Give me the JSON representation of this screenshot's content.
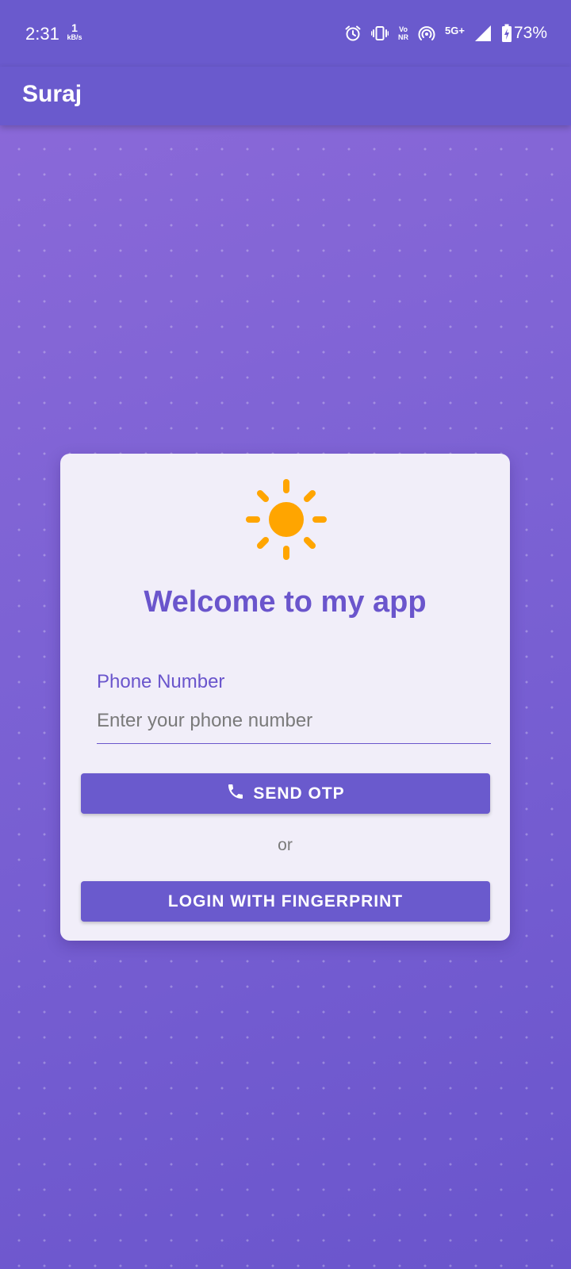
{
  "status_bar": {
    "time": "2:31",
    "net_speed_value": "1",
    "net_speed_unit": "kB/s",
    "icons": [
      "alarm-icon",
      "vibrate-icon",
      "vonr-icon",
      "hotspot-icon",
      "5g-plus-icon",
      "signal-icon",
      "battery-charging-icon"
    ],
    "vo_label": "Vo",
    "nr_label": "NR",
    "network_label": "5G+",
    "battery_percent": "73%"
  },
  "app_bar": {
    "title": "Suraj"
  },
  "card": {
    "logo_icon": "sun-icon",
    "logo_color": "#FFA500",
    "welcome_text": "Welcome to my app",
    "phone_field": {
      "label": "Phone Number",
      "placeholder": "Enter your phone number",
      "value": ""
    },
    "send_otp_button": {
      "icon": "phone-icon",
      "label": "SEND OTP"
    },
    "separator_text": "or",
    "fingerprint_button": {
      "label": "LOGIN WITH FINGERPRINT"
    }
  },
  "colors": {
    "primary": "#6A5ACD",
    "background_top": "#8D6AD9",
    "background_bottom": "#6A55CC",
    "card_background": "#F1EEF9",
    "accent": "#FFA500"
  }
}
